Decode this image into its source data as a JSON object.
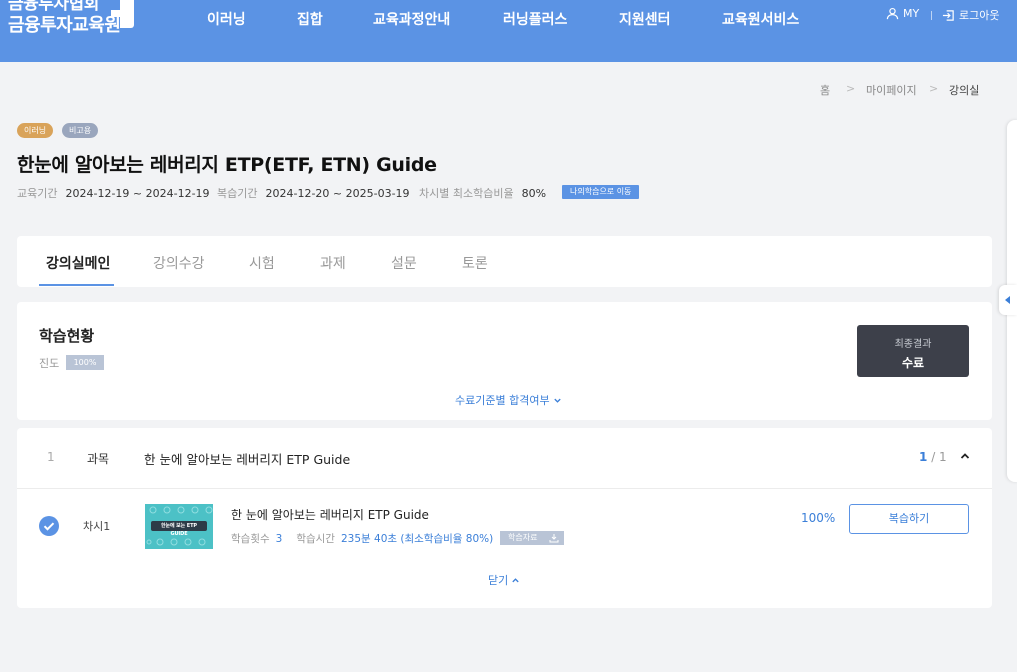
{
  "header": {
    "logo_line1": "금융투자협회",
    "logo_line2": "금융투자교육원",
    "nav": [
      "이러닝",
      "집합",
      "교육과정안내",
      "러닝플러스",
      "지원센터",
      "교육원서비스"
    ],
    "my_label": "MY",
    "logout_label": "로그아웃",
    "bg_color": "#5b93e4"
  },
  "breadcrumb": [
    "홈",
    "마이페이지",
    "강의실"
  ],
  "course": {
    "badges": [
      "이러닝",
      "비고용"
    ],
    "title": "한눈에 알아보는 레버리지 ETP(ETF, ETN) Guide",
    "period_label": "교육기간",
    "period_value": "2024-12-19 ~ 2024-12-19",
    "review_label": "복습기간",
    "review_value": "2024-12-20 ~ 2025-03-19",
    "min_rate_label": "차시별 최소학습비율",
    "min_rate_value": "80%",
    "move_button": "나의학습으로 이동"
  },
  "tabs": [
    "강의실메인",
    "강의수강",
    "시험",
    "과제",
    "설문",
    "토론"
  ],
  "status": {
    "title": "학습현황",
    "progress_label": "진도",
    "progress_value": "100%",
    "result_label": "최종결과",
    "result_value": "수료",
    "criteria_link": "수료기준별 합격여부"
  },
  "subject": {
    "number": "1",
    "type": "과목",
    "title": "한 눈에 알아보는 레버리지 ETP Guide",
    "count_current": "1",
    "count_total": "/ 1"
  },
  "session": {
    "label": "차시1",
    "thumbnail_text": "한눈에 보는 ETP GUIDE",
    "title": "한 눈에 알아보는 레버리지 ETP Guide",
    "count_label": "학습횟수",
    "count_value": "3",
    "time_label": "학습시간",
    "time_value": "235분 40초 (최소학습비율 80%)",
    "material_button": "학습자료",
    "percent": "100%",
    "review_button": "복습하기"
  },
  "close_label": "닫기"
}
